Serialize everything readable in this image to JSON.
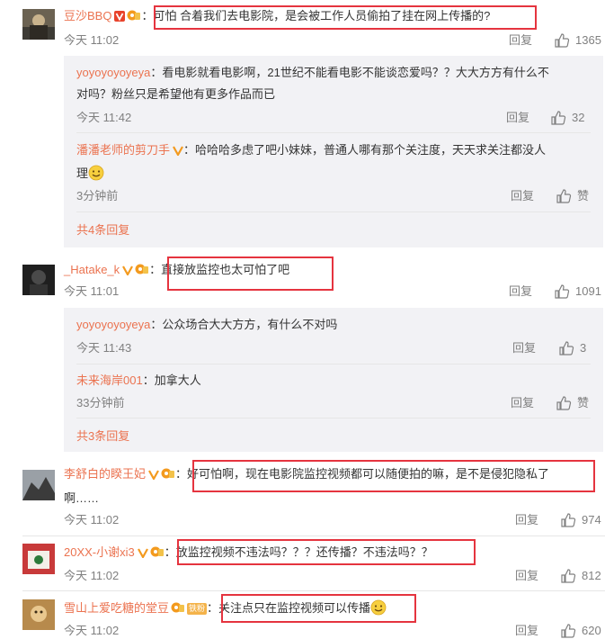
{
  "colors": {
    "username": "#eb7350",
    "highlight": "#e5343f",
    "reply_bg": "#f2f2f5",
    "meta": "#808080"
  },
  "comments": [
    {
      "user": "豆沙BBQ",
      "sep": "：",
      "text": "可怕 合着我们去电影院，是会被工作人员偷拍了挂在网上传播的?",
      "time": "今天 11:02",
      "reply_label": "回复",
      "likes": "1365",
      "replies": [
        {
          "user": "yoyoyoyoyeya",
          "sep": "：",
          "text": "看电影就看电影啊，21世纪不能看电影不能谈恋爱吗？？大大方方有什么不对吗？粉丝只是希望他有更多作品而已",
          "time": "今天 11:42",
          "reply_label": "回复",
          "likes": "32"
        },
        {
          "user": "潘潘老师的剪刀手",
          "sep": "：",
          "text": "哈哈哈多虑了吧小妹妹，普通人哪有那个关注度，天天求关注都没人理",
          "time": "3分钟前",
          "reply_label": "回复",
          "likes": "赞"
        }
      ],
      "total": "共4条回复"
    },
    {
      "user": "_Hatake_k",
      "sep": "：",
      "text": "直接放监控也太可怕了吧",
      "time": "今天 11:01",
      "reply_label": "回复",
      "likes": "1091",
      "replies": [
        {
          "user": "yoyoyoyoyeya",
          "sep": "：",
          "text": "公众场合大大方方，有什么不对吗",
          "time": "今天 11:43",
          "reply_label": "回复",
          "likes": "3"
        },
        {
          "user": "未来海岸001",
          "sep": "：",
          "text": "加拿大人",
          "time": "33分钟前",
          "reply_label": "回复",
          "likes": "赞"
        }
      ],
      "total": "共3条回复"
    },
    {
      "user": "李舒白的睽王妃",
      "sep": "：",
      "text": "好可怕啊，现在电影院监控视频都可以随便拍的嘛，是不是侵犯隐私了啊……",
      "time": "今天 11:02",
      "reply_label": "回复",
      "likes": "974"
    },
    {
      "user": "20XX-小谢xi3",
      "sep": "：",
      "text": "放监控视频不违法吗？？？还传播？不违法吗？？",
      "time": "今天 11:02",
      "reply_label": "回复",
      "likes": "812"
    },
    {
      "user": "雪山上爱吃糖的堂豆",
      "sep": "：",
      "fan_chip": "铁粉",
      "text": "关注点只在监控视频可以传播",
      "time": "今天 11:02",
      "reply_label": "回复",
      "likes": "620"
    }
  ]
}
